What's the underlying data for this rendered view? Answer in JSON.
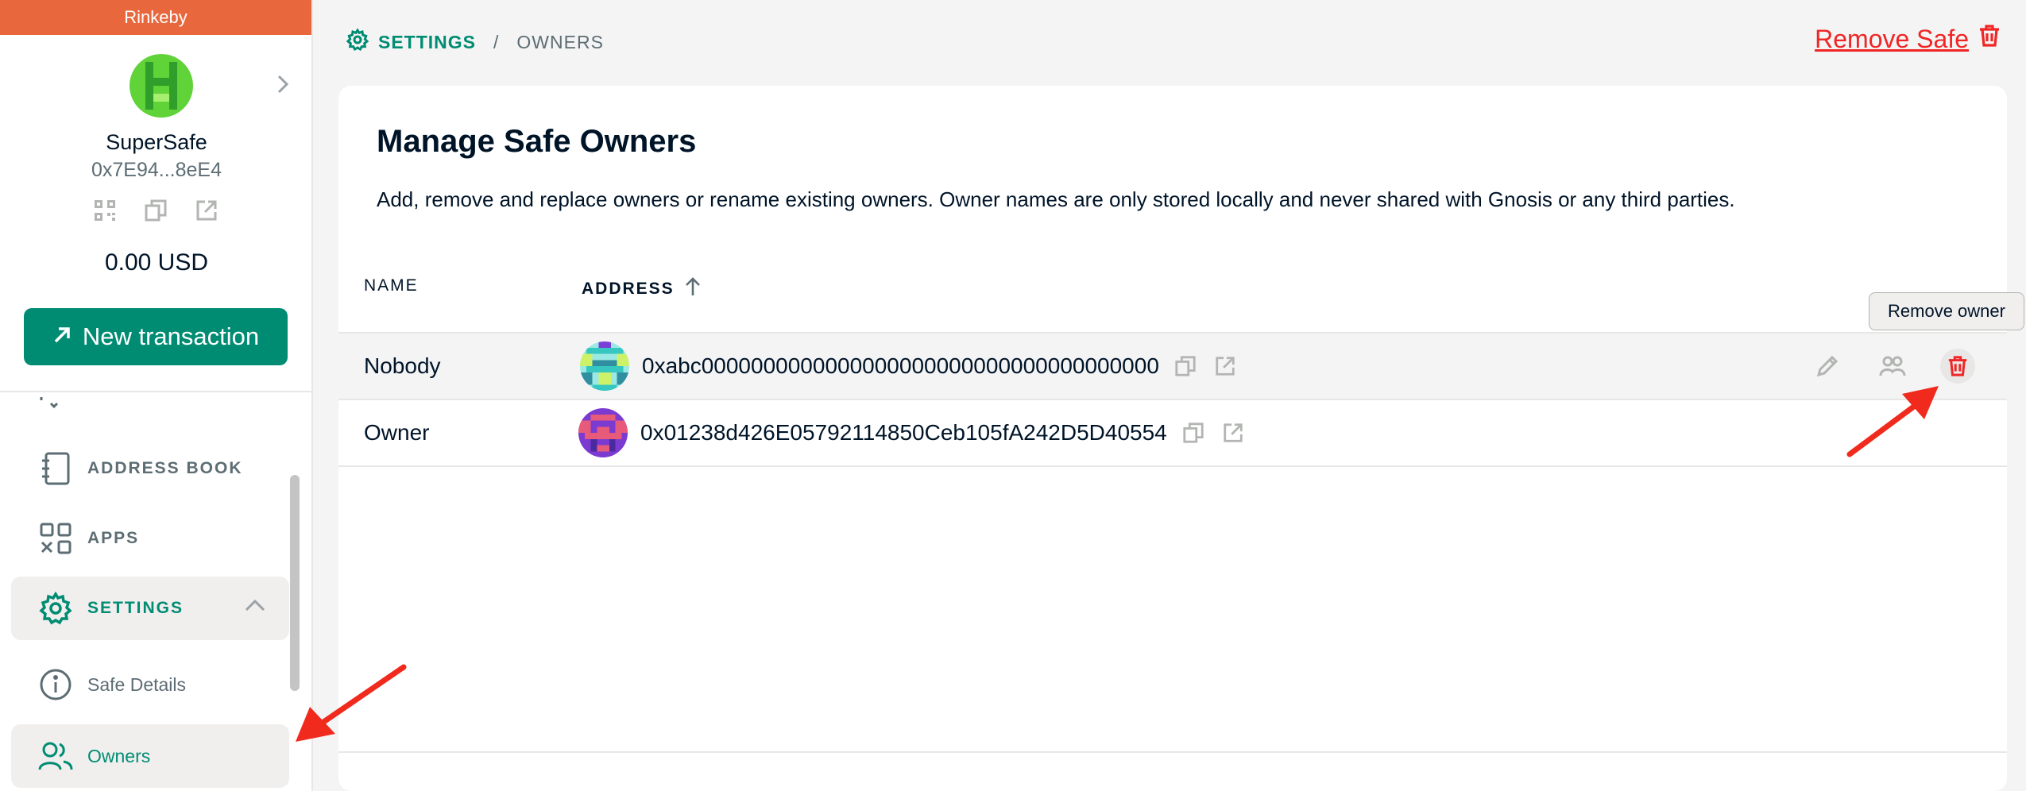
{
  "sidebar": {
    "network": "Rinkeby",
    "safe_name": "SuperSafe",
    "safe_address": "0x7E94...8eE4",
    "balance": "0.00 USD",
    "new_transaction_label": "New transaction",
    "nav": {
      "address_book": "ADDRESS BOOK",
      "apps": "APPS",
      "settings": "SETTINGS",
      "safe_details": "Safe Details",
      "owners": "Owners"
    }
  },
  "breadcrumb": {
    "settings": "SETTINGS",
    "separator": "/",
    "owners": "OWNERS"
  },
  "remove_safe_label": "Remove Safe",
  "card": {
    "title": "Manage Safe Owners",
    "description": "Add, remove and replace owners or rename existing owners. Owner names are only stored locally and never shared with Gnosis or any third parties.",
    "columns": {
      "name": "NAME",
      "address": "ADDRESS"
    },
    "rows": [
      {
        "name": "Nobody",
        "address": "0xabc0000000000000000000000000000000000000"
      },
      {
        "name": "Owner",
        "address": "0x01238d426E05792114850Ceb105fA242D5D40554"
      }
    ]
  },
  "tooltip": "Remove owner",
  "colors": {
    "brand_green": "#008c73",
    "network_orange": "#e8673c",
    "danger_red": "#f02525",
    "annotation_red": "#f02a1d"
  }
}
